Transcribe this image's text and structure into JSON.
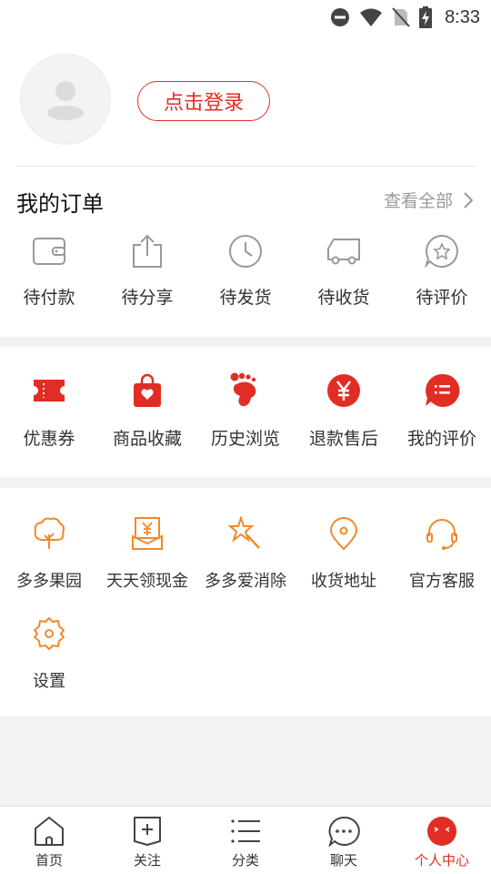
{
  "status_bar": {
    "time": "8:33"
  },
  "profile": {
    "login_label": "点击登录"
  },
  "orders": {
    "title": "我的订单",
    "view_all": "查看全部",
    "items": [
      {
        "label": "待付款",
        "icon": "wallet-icon"
      },
      {
        "label": "待分享",
        "icon": "share-icon"
      },
      {
        "label": "待发货",
        "icon": "clock-icon"
      },
      {
        "label": "待收货",
        "icon": "truck-icon"
      },
      {
        "label": "待评价",
        "icon": "star-comment-icon"
      }
    ]
  },
  "services": [
    {
      "label": "优惠券",
      "icon": "coupon-icon"
    },
    {
      "label": "商品收藏",
      "icon": "favorite-bag-icon"
    },
    {
      "label": "历史浏览",
      "icon": "footprint-icon"
    },
    {
      "label": "退款售后",
      "icon": "refund-yen-icon"
    },
    {
      "label": "我的评价",
      "icon": "review-list-icon"
    }
  ],
  "tools": [
    {
      "label": "多多果园",
      "icon": "tree-icon"
    },
    {
      "label": "天天领现金",
      "icon": "cash-envelope-icon"
    },
    {
      "label": "多多爱消除",
      "icon": "star-wand-icon"
    },
    {
      "label": "收货地址",
      "icon": "location-pin-icon"
    },
    {
      "label": "官方客服",
      "icon": "headset-icon"
    },
    {
      "label": "设置",
      "icon": "settings-gear-icon"
    }
  ],
  "tabs": [
    {
      "label": "首页",
      "icon": "home-icon",
      "active": false
    },
    {
      "label": "关注",
      "icon": "follow-icon",
      "active": false
    },
    {
      "label": "分类",
      "icon": "category-list-icon",
      "active": false
    },
    {
      "label": "聊天",
      "icon": "chat-icon",
      "active": false
    },
    {
      "label": "个人中心",
      "icon": "profile-face-icon",
      "active": true
    }
  ],
  "colors": {
    "accent": "#e02e24",
    "orange": "#f08a2a",
    "grey_icon": "#9e9e9e",
    "background": "#f2f2f2"
  }
}
